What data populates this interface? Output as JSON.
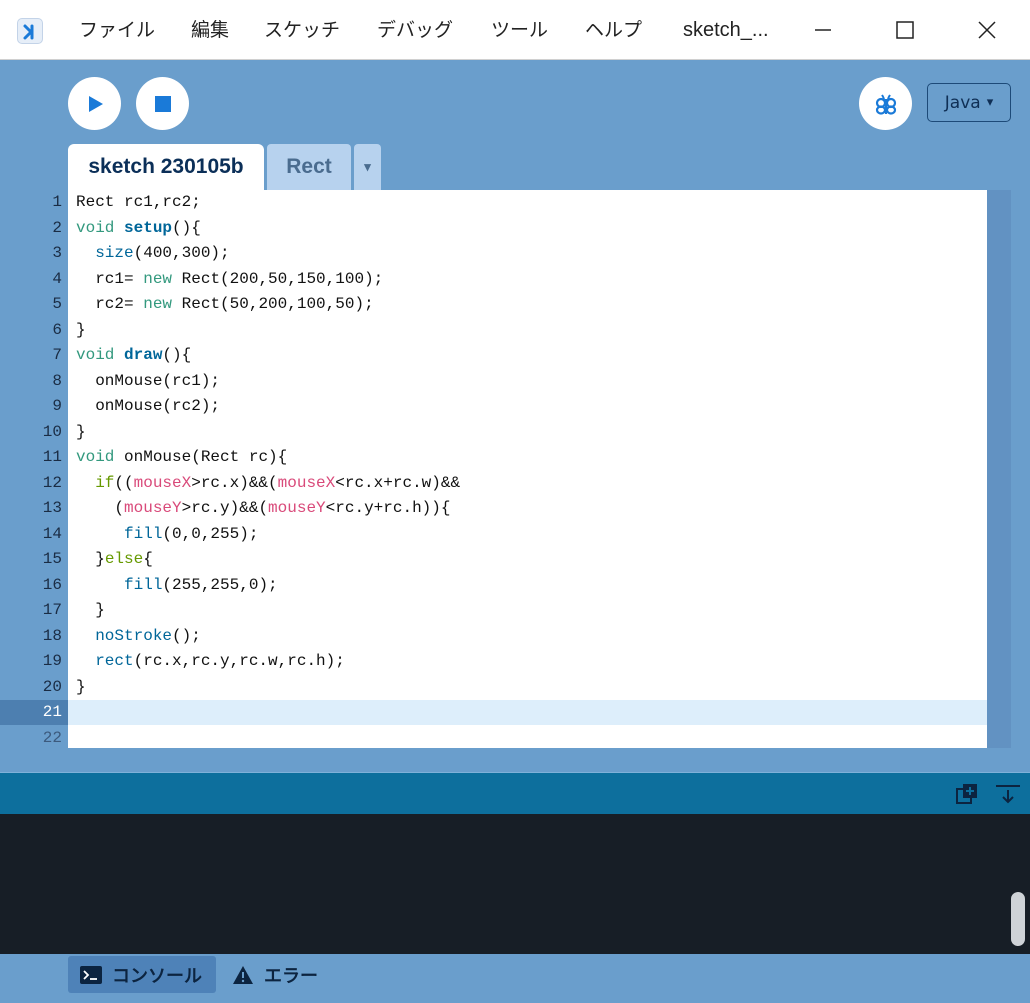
{
  "menu": {
    "items": [
      "ファイル",
      "編集",
      "スケッチ",
      "デバッグ",
      "ツール",
      "ヘルプ"
    ],
    "window_title": "sketch_..."
  },
  "toolbar": {
    "run_icon": "play-icon",
    "stop_icon": "stop-icon",
    "debug_icon": "debugger-butterfly-icon",
    "mode_label": "Java",
    "mode_arrow": "▾"
  },
  "tabs": {
    "active": "sketch 230105b",
    "inactive": "Rect",
    "menu_arrow": "▾"
  },
  "editor": {
    "line_numbers": [
      "1",
      "2",
      "3",
      "4",
      "5",
      "6",
      "7",
      "8",
      "9",
      "10",
      "11",
      "12",
      "13",
      "14",
      "15",
      "16",
      "17",
      "18",
      "19",
      "20",
      "21",
      "22"
    ],
    "current_line": "21",
    "lines": [
      [
        {
          "t": "Rect rc1,rc2;",
          "c": ""
        }
      ],
      [
        {
          "t": "void ",
          "c": "kw"
        },
        {
          "t": "setup",
          "c": "fnb"
        },
        {
          "t": "(){",
          "c": ""
        }
      ],
      [
        {
          "t": "  ",
          "c": ""
        },
        {
          "t": "size",
          "c": "fn"
        },
        {
          "t": "(400,300);",
          "c": ""
        }
      ],
      [
        {
          "t": "  rc1= ",
          "c": ""
        },
        {
          "t": "new",
          "c": "kw"
        },
        {
          "t": " Rect(200,50,150,100);",
          "c": ""
        }
      ],
      [
        {
          "t": "  rc2= ",
          "c": ""
        },
        {
          "t": "new",
          "c": "kw"
        },
        {
          "t": " Rect(50,200,100,50);",
          "c": ""
        }
      ],
      [
        {
          "t": "}",
          "c": ""
        }
      ],
      [
        {
          "t": "void ",
          "c": "kw"
        },
        {
          "t": "draw",
          "c": "fnb"
        },
        {
          "t": "(){",
          "c": ""
        }
      ],
      [
        {
          "t": "  onMouse(rc1);",
          "c": ""
        }
      ],
      [
        {
          "t": "  onMouse(rc2);",
          "c": ""
        }
      ],
      [
        {
          "t": "}",
          "c": ""
        }
      ],
      [
        {
          "t": "void ",
          "c": "kw"
        },
        {
          "t": "onMouse(Rect rc){",
          "c": ""
        }
      ],
      [
        {
          "t": "  ",
          "c": ""
        },
        {
          "t": "if",
          "c": "ctl"
        },
        {
          "t": "((",
          "c": ""
        },
        {
          "t": "mouseX",
          "c": "var"
        },
        {
          "t": ">rc.x)&&(",
          "c": ""
        },
        {
          "t": "mouseX",
          "c": "var"
        },
        {
          "t": "<rc.x+rc.w)&&",
          "c": ""
        }
      ],
      [
        {
          "t": "    (",
          "c": ""
        },
        {
          "t": "mouseY",
          "c": "var"
        },
        {
          "t": ">rc.y)&&(",
          "c": ""
        },
        {
          "t": "mouseY",
          "c": "var"
        },
        {
          "t": "<rc.y+rc.h)){",
          "c": ""
        }
      ],
      [
        {
          "t": "     ",
          "c": ""
        },
        {
          "t": "fill",
          "c": "fn"
        },
        {
          "t": "(0,0,255);",
          "c": ""
        }
      ],
      [
        {
          "t": "  }",
          "c": ""
        },
        {
          "t": "else",
          "c": "ctl"
        },
        {
          "t": "{",
          "c": ""
        }
      ],
      [
        {
          "t": "     ",
          "c": ""
        },
        {
          "t": "fill",
          "c": "fn"
        },
        {
          "t": "(255,255,0);",
          "c": ""
        }
      ],
      [
        {
          "t": "  }",
          "c": ""
        }
      ],
      [
        {
          "t": "  ",
          "c": ""
        },
        {
          "t": "noStroke",
          "c": "fn"
        },
        {
          "t": "();",
          "c": ""
        }
      ],
      [
        {
          "t": "  ",
          "c": ""
        },
        {
          "t": "rect",
          "c": "fn"
        },
        {
          "t": "(rc.x,rc.y,rc.w,rc.h);",
          "c": ""
        }
      ],
      [
        {
          "t": "}",
          "c": ""
        }
      ],
      [
        {
          "t": "",
          "c": ""
        }
      ],
      [
        {
          "t": "",
          "c": ""
        }
      ]
    ]
  },
  "console": {
    "copy_icon": "copy-add-icon",
    "collapse_icon": "collapse-down-icon",
    "tabs": [
      {
        "icon": "terminal-icon",
        "label": "コンソール"
      },
      {
        "icon": "warning-icon",
        "label": "エラー"
      }
    ]
  },
  "colors": {
    "accent": "#6a9ecc",
    "keyword": "#33997e",
    "function": "#006699",
    "control": "#669900",
    "variable": "#d94a7a",
    "console_bg": "#171e26"
  }
}
